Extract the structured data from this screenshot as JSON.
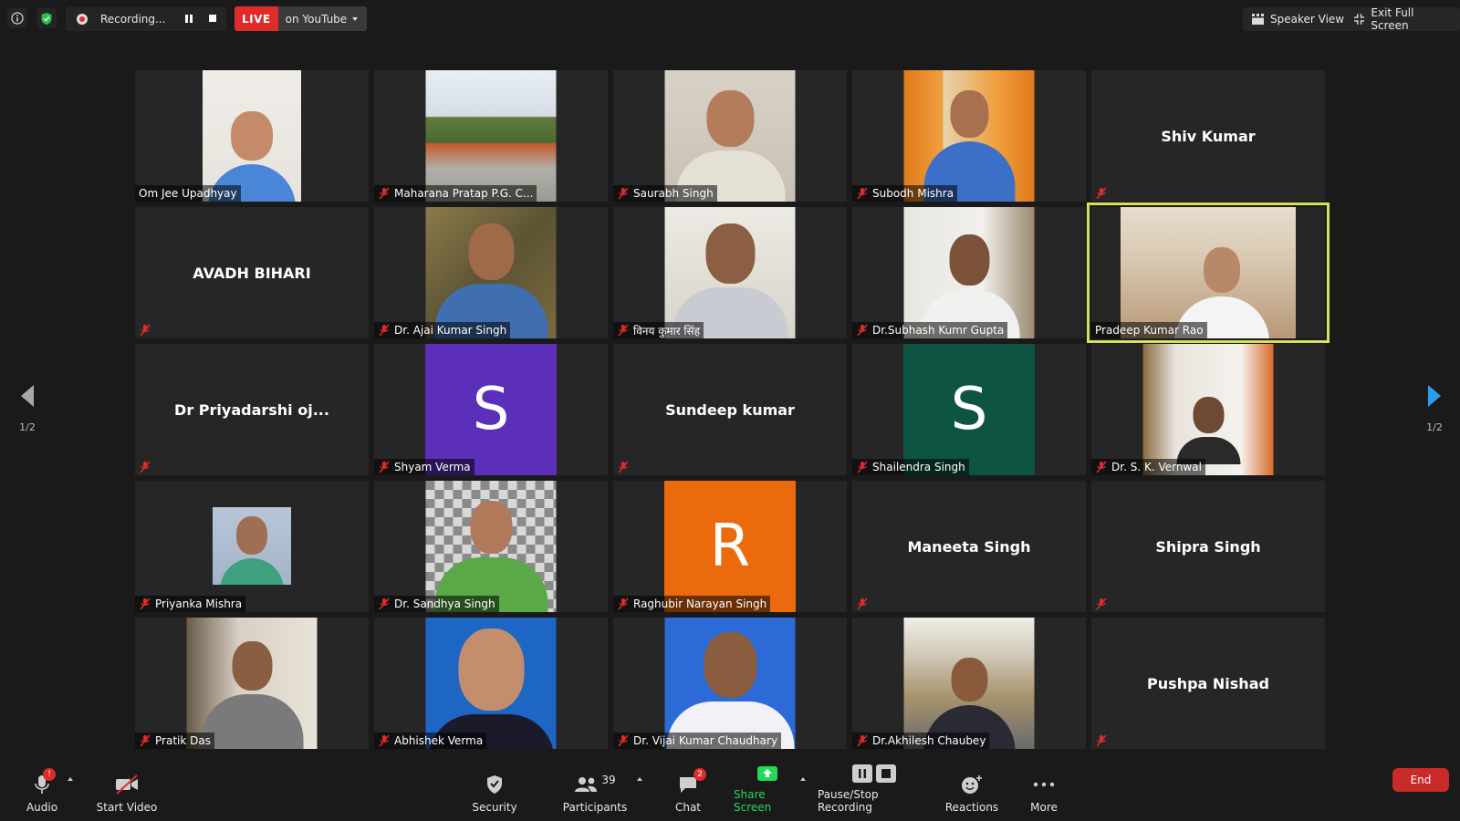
{
  "topbar": {
    "recording_label": "Recording...",
    "live_label": "LIVE",
    "live_destination": "on YouTube",
    "speaker_view_label": "Speaker View",
    "exit_fullscreen_label": "Exit Full Screen"
  },
  "gallery": {
    "page_indicator_left": "1/2",
    "page_indicator_right": "1/2",
    "tiles": [
      {
        "name": "Om Jee Upadhyay",
        "type": "video",
        "muted": false
      },
      {
        "name": "Maharana Pratap P.G. C...",
        "type": "video",
        "muted": true
      },
      {
        "name": "Saurabh Singh",
        "type": "video",
        "muted": true
      },
      {
        "name": "Subodh Mishra",
        "type": "video",
        "muted": true
      },
      {
        "name": "Shiv Kumar",
        "type": "name",
        "muted": true
      },
      {
        "name": "AVADH BIHARI",
        "type": "name",
        "muted": true
      },
      {
        "name": "Dr. Ajai Kumar Singh",
        "type": "video",
        "muted": true
      },
      {
        "name": "विनय कुमार सिंह",
        "type": "video",
        "muted": true
      },
      {
        "name": "Dr.Subhash Kumr Gupta",
        "type": "video",
        "muted": true
      },
      {
        "name": "Pradeep Kumar Rao",
        "type": "video",
        "muted": false,
        "active": true
      },
      {
        "name": "Dr Priyadarshi oj...",
        "type": "name",
        "muted": true
      },
      {
        "name": "Shyam Verma",
        "type": "avatar",
        "letter": "S",
        "color": "#5b2fb8",
        "muted": true
      },
      {
        "name": "Sundeep kumar",
        "type": "name",
        "muted": true
      },
      {
        "name": "Shailendra Singh",
        "type": "avatar",
        "letter": "S",
        "color": "#0d5443",
        "muted": true
      },
      {
        "name": "Dr. S. K. Vernwal",
        "type": "video",
        "muted": true
      },
      {
        "name": "Priyanka Mishra",
        "type": "video",
        "muted": true
      },
      {
        "name": "Dr. Sandhya Singh",
        "type": "video",
        "muted": true
      },
      {
        "name": "Raghubir Narayan Singh",
        "type": "avatar",
        "letter": "R",
        "color": "#ea6a0c",
        "muted": true
      },
      {
        "name": "Maneeta Singh",
        "type": "name",
        "muted": true
      },
      {
        "name": "Shipra Singh",
        "type": "name",
        "muted": true
      },
      {
        "name": "Pratik Das",
        "type": "video",
        "muted": true
      },
      {
        "name": "Abhishek Verma",
        "type": "video",
        "muted": true
      },
      {
        "name": "Dr. Vijai Kumar Chaudhary",
        "type": "video",
        "muted": true
      },
      {
        "name": "Dr.Akhilesh Chaubey",
        "type": "video",
        "muted": true
      },
      {
        "name": "Pushpa Nishad",
        "type": "name",
        "muted": true
      }
    ]
  },
  "toolbar": {
    "audio_label": "Audio",
    "audio_badge": "!",
    "video_label": "Start Video",
    "security_label": "Security",
    "participants_label": "Participants",
    "participants_count": "39",
    "chat_label": "Chat",
    "chat_badge": "2",
    "share_label": "Share Screen",
    "recording_label": "Pause/Stop Recording",
    "reactions_label": "Reactions",
    "more_label": "More",
    "end_label": "End"
  },
  "colors": {
    "share_green": "#23d959",
    "live_red": "#e02b2b",
    "active_outline": "#d6e05a",
    "end_red": "#c92a2a"
  }
}
